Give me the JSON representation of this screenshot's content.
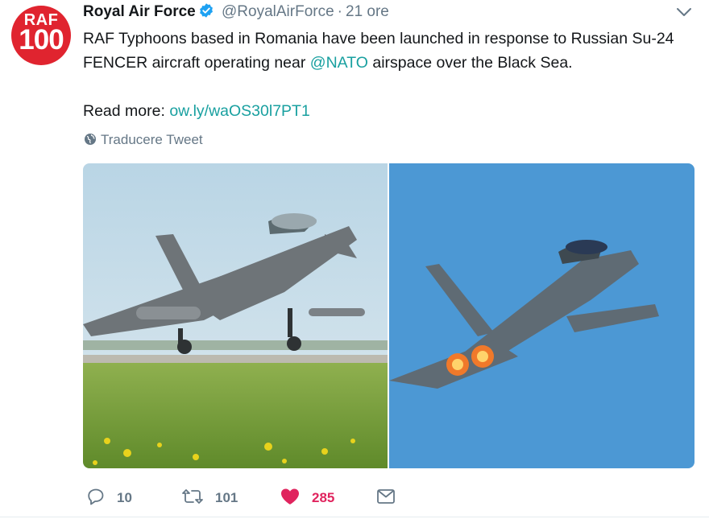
{
  "avatar": {
    "line1": "RAF",
    "line2": "100"
  },
  "header": {
    "name": "Royal Air Force",
    "handle": "@RoyalAirForce",
    "separator": "·",
    "time": "21 ore"
  },
  "tweet": {
    "text_before_mention": "RAF Typhoons based in Romania have been launched in response to Russian Su-24 FENCER aircraft operating near ",
    "mention": "@NATO",
    "text_after_mention": " airspace over the Black Sea.",
    "read_more_label": "Read more: ",
    "link": "ow.ly/waOS30l7PT1"
  },
  "translate_label": "Traducere Tweet",
  "actions": {
    "reply_count": "10",
    "retweet_count": "101",
    "like_count": "285"
  },
  "colors": {
    "brand_red": "#e0242f",
    "link_teal": "#19a0a0",
    "like_pink": "#e0245e",
    "muted": "#657786",
    "verified_blue": "#1da1f2"
  },
  "icons": [
    "verified-badge-icon",
    "chevron-down-icon",
    "globe-icon",
    "reply-icon",
    "retweet-icon",
    "heart-icon",
    "envelope-icon"
  ]
}
